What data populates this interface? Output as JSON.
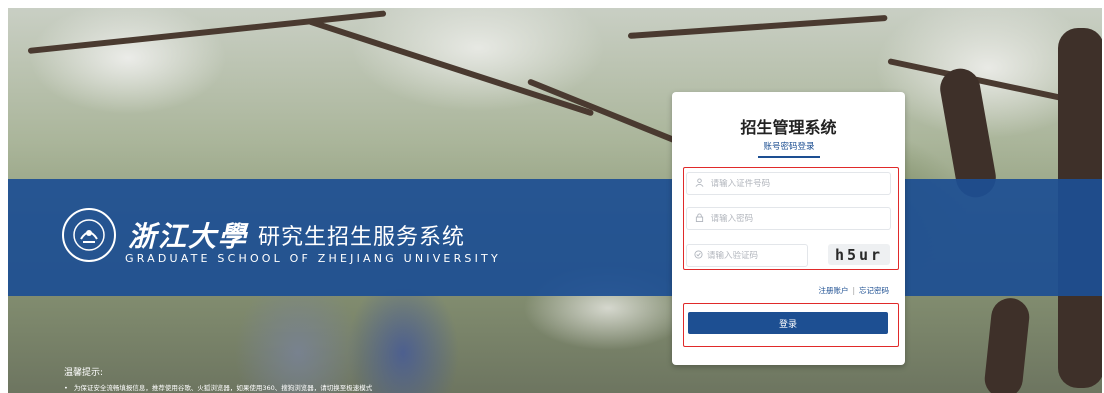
{
  "brand": {
    "name_cn": "浙江大學",
    "system_name": "研究生招生服务系统",
    "school_en": "GRADUATE SCHOOL OF ZHEJIANG UNIVERSITY"
  },
  "tips": {
    "title": "温馨提示:",
    "line1": "为保证安全流畅填报信息，推荐使用谷歌、火狐浏览器，如果使用360、搜狗浏览器，请切换至极速模式"
  },
  "login": {
    "title": "招生管理系统",
    "tab_label": "账号密码登录",
    "id_placeholder": "请输入证件号码",
    "password_placeholder": "请输入密码",
    "captcha_placeholder": "请输入验证码",
    "captcha_text": "h5ur",
    "register_link": "注册账户",
    "forgot_link": "忘记密码",
    "submit_label": "登录"
  },
  "colors": {
    "banner": "#1d4f92",
    "accent": "#1d4f92",
    "highlight_box": "#e02a2a"
  },
  "icons": {
    "id_field": "user-icon",
    "password_field": "lock-icon",
    "captcha_field": "shield-check-icon"
  }
}
